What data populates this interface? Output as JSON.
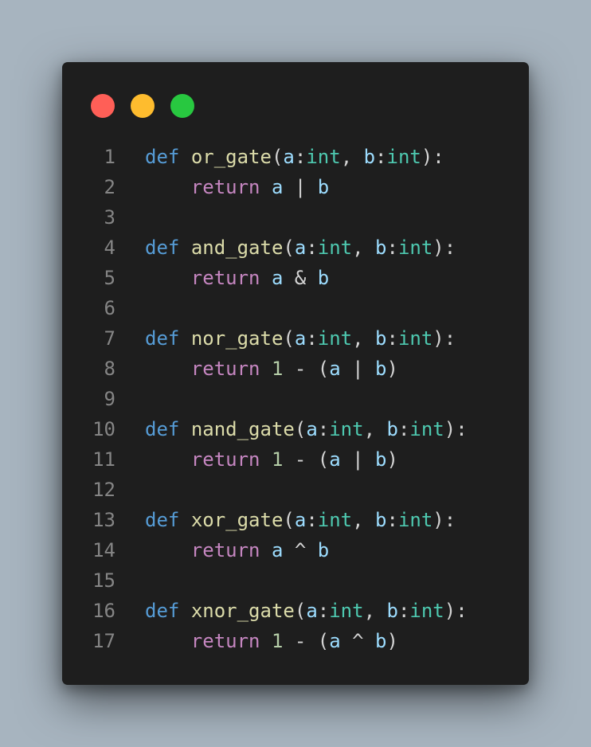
{
  "window": {
    "controls": {
      "close_color": "#ff5f57",
      "minimize_color": "#febc2e",
      "maximize_color": "#28c840"
    }
  },
  "theme": {
    "background": "#1e1e1e",
    "line_number": "#858585",
    "keyword_def": "#569cd6",
    "keyword_return": "#c586c0",
    "function": "#dcdcaa",
    "parameter": "#9cdcfe",
    "type": "#4ec9b0",
    "number": "#b5cea8",
    "operator": "#d4d4d4"
  },
  "code": {
    "lines": [
      {
        "num": "1",
        "tokens": [
          [
            "def",
            "kw-def"
          ],
          [
            " ",
            "punc"
          ],
          [
            "or_gate",
            "fn"
          ],
          [
            "(",
            "punc"
          ],
          [
            "a",
            "param"
          ],
          [
            ":",
            "punc"
          ],
          [
            "int",
            "type"
          ],
          [
            ", ",
            "punc"
          ],
          [
            "b",
            "param"
          ],
          [
            ":",
            "punc"
          ],
          [
            "int",
            "type"
          ],
          [
            "):",
            "punc"
          ]
        ]
      },
      {
        "num": "2",
        "tokens": [
          [
            "    ",
            "punc"
          ],
          [
            "return",
            "kw-ret"
          ],
          [
            " ",
            "punc"
          ],
          [
            "a",
            "param"
          ],
          [
            " | ",
            "punc"
          ],
          [
            "b",
            "param"
          ]
        ]
      },
      {
        "num": "3",
        "tokens": []
      },
      {
        "num": "4",
        "tokens": [
          [
            "def",
            "kw-def"
          ],
          [
            " ",
            "punc"
          ],
          [
            "and_gate",
            "fn"
          ],
          [
            "(",
            "punc"
          ],
          [
            "a",
            "param"
          ],
          [
            ":",
            "punc"
          ],
          [
            "int",
            "type"
          ],
          [
            ", ",
            "punc"
          ],
          [
            "b",
            "param"
          ],
          [
            ":",
            "punc"
          ],
          [
            "int",
            "type"
          ],
          [
            "):",
            "punc"
          ]
        ]
      },
      {
        "num": "5",
        "tokens": [
          [
            "    ",
            "punc"
          ],
          [
            "return",
            "kw-ret"
          ],
          [
            " ",
            "punc"
          ],
          [
            "a",
            "param"
          ],
          [
            " & ",
            "punc"
          ],
          [
            "b",
            "param"
          ]
        ]
      },
      {
        "num": "6",
        "tokens": []
      },
      {
        "num": "7",
        "tokens": [
          [
            "def",
            "kw-def"
          ],
          [
            " ",
            "punc"
          ],
          [
            "nor_gate",
            "fn"
          ],
          [
            "(",
            "punc"
          ],
          [
            "a",
            "param"
          ],
          [
            ":",
            "punc"
          ],
          [
            "int",
            "type"
          ],
          [
            ", ",
            "punc"
          ],
          [
            "b",
            "param"
          ],
          [
            ":",
            "punc"
          ],
          [
            "int",
            "type"
          ],
          [
            "):",
            "punc"
          ]
        ]
      },
      {
        "num": "8",
        "tokens": [
          [
            "    ",
            "punc"
          ],
          [
            "return",
            "kw-ret"
          ],
          [
            " ",
            "punc"
          ],
          [
            "1",
            "num"
          ],
          [
            " - (",
            "punc"
          ],
          [
            "a",
            "param"
          ],
          [
            " | ",
            "punc"
          ],
          [
            "b",
            "param"
          ],
          [
            ")",
            "punc"
          ]
        ]
      },
      {
        "num": "9",
        "tokens": []
      },
      {
        "num": "10",
        "tokens": [
          [
            "def",
            "kw-def"
          ],
          [
            " ",
            "punc"
          ],
          [
            "nand_gate",
            "fn"
          ],
          [
            "(",
            "punc"
          ],
          [
            "a",
            "param"
          ],
          [
            ":",
            "punc"
          ],
          [
            "int",
            "type"
          ],
          [
            ", ",
            "punc"
          ],
          [
            "b",
            "param"
          ],
          [
            ":",
            "punc"
          ],
          [
            "int",
            "type"
          ],
          [
            "):",
            "punc"
          ]
        ]
      },
      {
        "num": "11",
        "tokens": [
          [
            "    ",
            "punc"
          ],
          [
            "return",
            "kw-ret"
          ],
          [
            " ",
            "punc"
          ],
          [
            "1",
            "num"
          ],
          [
            " - (",
            "punc"
          ],
          [
            "a",
            "param"
          ],
          [
            " | ",
            "punc"
          ],
          [
            "b",
            "param"
          ],
          [
            ")",
            "punc"
          ]
        ]
      },
      {
        "num": "12",
        "tokens": []
      },
      {
        "num": "13",
        "tokens": [
          [
            "def",
            "kw-def"
          ],
          [
            " ",
            "punc"
          ],
          [
            "xor_gate",
            "fn"
          ],
          [
            "(",
            "punc"
          ],
          [
            "a",
            "param"
          ],
          [
            ":",
            "punc"
          ],
          [
            "int",
            "type"
          ],
          [
            ", ",
            "punc"
          ],
          [
            "b",
            "param"
          ],
          [
            ":",
            "punc"
          ],
          [
            "int",
            "type"
          ],
          [
            "):",
            "punc"
          ]
        ]
      },
      {
        "num": "14",
        "tokens": [
          [
            "    ",
            "punc"
          ],
          [
            "return",
            "kw-ret"
          ],
          [
            " ",
            "punc"
          ],
          [
            "a",
            "param"
          ],
          [
            " ^ ",
            "punc"
          ],
          [
            "b",
            "param"
          ]
        ]
      },
      {
        "num": "15",
        "tokens": []
      },
      {
        "num": "16",
        "tokens": [
          [
            "def",
            "kw-def"
          ],
          [
            " ",
            "punc"
          ],
          [
            "xnor_gate",
            "fn"
          ],
          [
            "(",
            "punc"
          ],
          [
            "a",
            "param"
          ],
          [
            ":",
            "punc"
          ],
          [
            "int",
            "type"
          ],
          [
            ", ",
            "punc"
          ],
          [
            "b",
            "param"
          ],
          [
            ":",
            "punc"
          ],
          [
            "int",
            "type"
          ],
          [
            "):",
            "punc"
          ]
        ]
      },
      {
        "num": "17",
        "tokens": [
          [
            "    ",
            "punc"
          ],
          [
            "return",
            "kw-ret"
          ],
          [
            " ",
            "punc"
          ],
          [
            "1",
            "num"
          ],
          [
            " - (",
            "punc"
          ],
          [
            "a",
            "param"
          ],
          [
            " ^ ",
            "punc"
          ],
          [
            "b",
            "param"
          ],
          [
            ")",
            "punc"
          ]
        ]
      }
    ]
  }
}
